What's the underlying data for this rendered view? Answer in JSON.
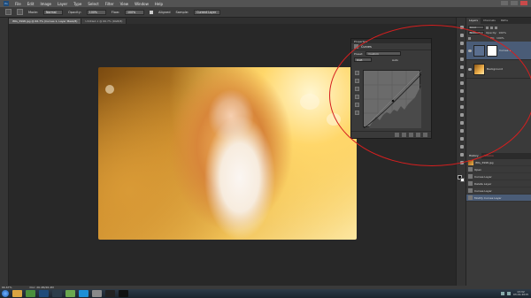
{
  "app": {
    "logo": "Ps"
  },
  "menu": [
    "File",
    "Edit",
    "Image",
    "Layer",
    "Type",
    "Select",
    "Filter",
    "View",
    "Window",
    "Help"
  ],
  "options_bar": {
    "mode_label": "Mode:",
    "mode_value": "Normal",
    "opacity_label": "Opacity:",
    "opacity_value": "100%",
    "flow_label": "Flow:",
    "flow_value": "100%",
    "aligned_label": "Aligned",
    "sample_label": "Sample:",
    "sample_value": "Current Layer"
  },
  "document_tabs": [
    {
      "label": "IMG_3998.jpg @ 66.7% (Curves 1, Layer Mask/8)",
      "active": true
    },
    {
      "label": "Untitled-1 @ 66.7% (RGB/8)",
      "active": false
    }
  ],
  "properties_panel": {
    "tab": "Properties",
    "title": "Curves",
    "preset_label": "Preset:",
    "preset_value": "Custom",
    "channel_value": "RGB",
    "auto_label": "Auto"
  },
  "layers_panel": {
    "tabs": [
      "Layers",
      "Channels",
      "Paths"
    ],
    "kind_label": "Kind",
    "blend_value": "Normal",
    "opacity_label": "Opacity:",
    "opacity_value": "100%",
    "fill_label": "Fill:",
    "fill_value": "100%",
    "layers": [
      {
        "name": "Curves 1",
        "selected": true
      },
      {
        "name": "Background",
        "selected": false
      }
    ]
  },
  "history_panel": {
    "tabs": [
      "History",
      "Actions"
    ],
    "items": [
      {
        "label": "IMG_3998.jpg",
        "selected": false
      },
      {
        "label": "Open",
        "selected": false
      },
      {
        "label": "Curves Layer",
        "selected": false
      },
      {
        "label": "Delete Layer",
        "selected": false
      },
      {
        "label": "Curves Layer",
        "selected": false
      },
      {
        "label": "Modify Curves Layer",
        "selected": true
      }
    ]
  },
  "status_bar": {
    "zoom": "66.67%",
    "doc": "Doc: 26.4M/26.4M"
  },
  "taskbar": {
    "apps": [
      {
        "name": "explorer",
        "color": "#d9a441"
      },
      {
        "name": "chrome",
        "color": "#4a8f3c"
      },
      {
        "name": "photoshop",
        "color": "#1e4b7a"
      },
      {
        "name": "lightroom",
        "color": "#2c3d4a"
      },
      {
        "name": "app-green",
        "color": "#6aa84f"
      },
      {
        "name": "skype",
        "color": "#1c8fd6"
      },
      {
        "name": "app-silver",
        "color": "#8a8a8a"
      },
      {
        "name": "app-dark",
        "color": "#222222"
      },
      {
        "name": "app-black",
        "color": "#111111"
      }
    ],
    "time": "13:32",
    "date": "03.01.2015"
  },
  "accent": {
    "selection": "#4a5c77",
    "annotation": "#d51f1f"
  }
}
